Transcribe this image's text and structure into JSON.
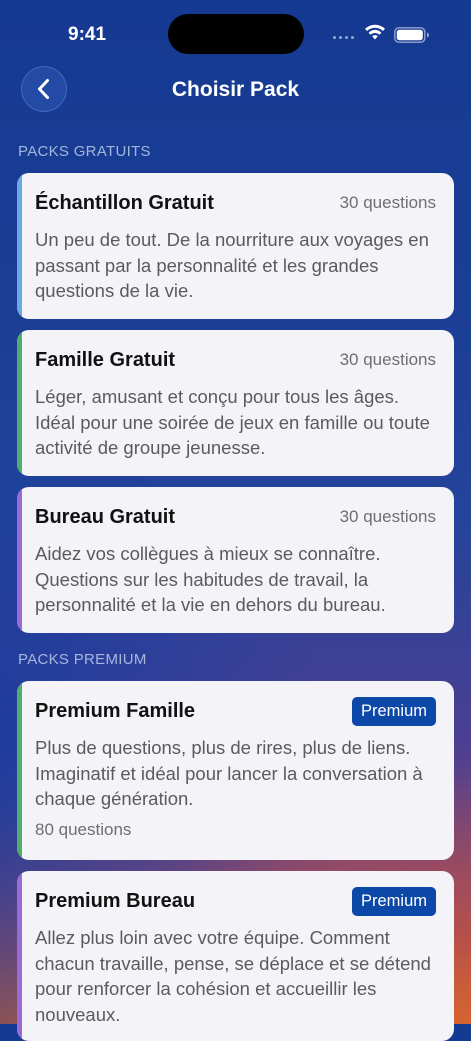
{
  "status": {
    "time": "9:41"
  },
  "nav": {
    "title": "Choisir Pack",
    "back_icon": "chevron-left-icon"
  },
  "sections": {
    "free_header": "PACKS GRATUITS",
    "premium_header": "PACKS PREMIUM"
  },
  "free_packs": [
    {
      "title": "Échantillon Gratuit",
      "count": "30 questions",
      "description": "Un peu de tout. De la nourriture aux voyages en passant par la personnalité et les grandes questions de la vie.",
      "accent": "#6aa8e6"
    },
    {
      "title": "Famille Gratuit",
      "count": "30 questions",
      "description": "Léger, amusant et conçu pour tous les âges. Idéal pour une soirée de jeux en famille ou toute activité de groupe jeunesse.",
      "accent": "#4fae6e"
    },
    {
      "title": "Bureau Gratuit",
      "count": "30 questions",
      "description": "Aidez vos collègues à mieux se connaître. Questions sur les habitudes de travail, la personnalité et la vie en dehors du bureau.",
      "accent": "#9a6ad6"
    }
  ],
  "premium_packs": [
    {
      "title": "Premium Famille",
      "badge": "Premium",
      "description": "Plus de questions, plus de rires, plus de liens. Imaginatif et idéal pour lancer la conversation à chaque génération.",
      "count": "80 questions",
      "accent": "#4fae6e"
    },
    {
      "title": "Premium Bureau",
      "badge": "Premium",
      "description": "Allez plus loin avec votre équipe. Comment chacun travaille, pense, se déplace et se détend pour renforcer la cohésion et accueillir les nouveaux.",
      "accent": "#9a6ad6"
    }
  ],
  "colors": {
    "badge_bg": "#0b48a8",
    "card_bg": "#f3f3f8"
  }
}
